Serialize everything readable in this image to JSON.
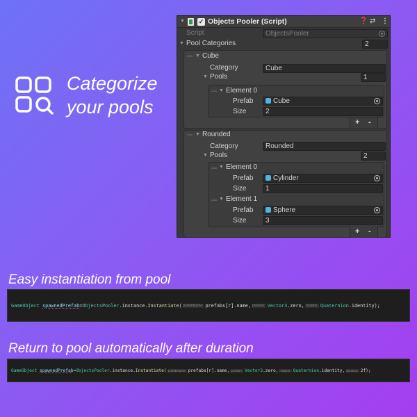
{
  "hero": {
    "line1": "Categorize",
    "line2": "your pools",
    "icon": "category-search-icon"
  },
  "inspector": {
    "title": "Objects Pooler (Script)",
    "script_label": "Script",
    "script_value": "ObjectsPooler",
    "pool_categories_label": "Pool Categories",
    "pool_categories_count": "2",
    "categories": [
      {
        "name": "Cube",
        "category_label": "Category",
        "category_value": "Cube",
        "pools_label": "Pools",
        "pools_count": "1",
        "elements": [
          {
            "label": "Element 0",
            "prefab_label": "Prefab",
            "prefab": "Cube",
            "size_label": "Size",
            "size": "2"
          }
        ]
      },
      {
        "name": "Rounded",
        "category_label": "Category",
        "category_value": "Rounded",
        "pools_label": "Pools",
        "pools_count": "2",
        "elements": [
          {
            "label": "Element 0",
            "prefab_label": "Prefab",
            "prefab": "Cylinder",
            "size_label": "Size",
            "size": "1"
          },
          {
            "label": "Element 1",
            "prefab_label": "Prefab",
            "prefab": "Sphere",
            "size_label": "Size",
            "size": "3"
          }
        ]
      }
    ],
    "add": "+",
    "remove": "-"
  },
  "section1": {
    "title": "Easy instantiation from pool",
    "code": {
      "type": "GameObject",
      "var": "spawnedPrefab",
      "eq": " = ",
      "cls": "ObjectsPooler",
      "inst": ".instance.",
      "method": "Instantiate",
      "open": "(",
      "h1": "prefabName:",
      "a1": "prefabs[r].name, ",
      "h2": "position:",
      "a2t": "Vector3",
      "a2": ".zero, ",
      "h3": "rotation:",
      "a3t": "Quaternion",
      "a3": ".identity);"
    }
  },
  "section2": {
    "title": "Return to pool automatically after duration",
    "code": {
      "type": "GameObject",
      "var": "spawnedPrefab",
      "eq": " = ",
      "cls": "ObjectsPooler",
      "inst": ".instance.",
      "method": "Instantiate",
      "open": "(",
      "h1": "prefabName:",
      "a1": "prefabs[r].name, ",
      "h2": "position:",
      "a2t": "Vector3",
      "a2": ".zero, ",
      "h3": "rotation:",
      "a3t": "Quaternion",
      "a3": ".identity, ",
      "h4": "duration:",
      "a4": "2f);"
    }
  }
}
